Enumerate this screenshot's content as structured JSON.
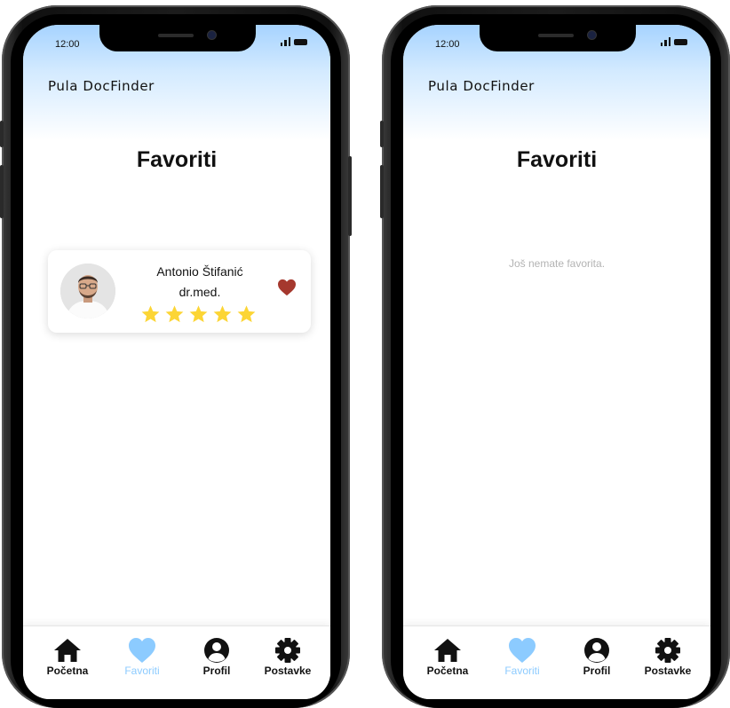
{
  "status_bar": {
    "time": "12:00"
  },
  "app_title": "Pula DocFinder",
  "page_title": "Favoriti",
  "favorites": [
    {
      "name": "Antonio Štifanić",
      "title": "dr.med.",
      "rating": 5,
      "favorited": true
    }
  ],
  "empty_message": "Još nemate favorita.",
  "nav": [
    {
      "label": "Početna",
      "icon": "home-icon",
      "active": false
    },
    {
      "label": "Favoriti",
      "icon": "heart-icon",
      "active": true
    },
    {
      "label": "Profil",
      "icon": "user-icon",
      "active": false
    },
    {
      "label": "Postavke",
      "icon": "gear-icon",
      "active": false
    }
  ],
  "colors": {
    "header_gradient": "#a6d3ff",
    "nav_active": "#8ccbff",
    "favorite_heart": "#a5382e",
    "star": "#fcd535",
    "empty_text": "#b3b3b3"
  }
}
